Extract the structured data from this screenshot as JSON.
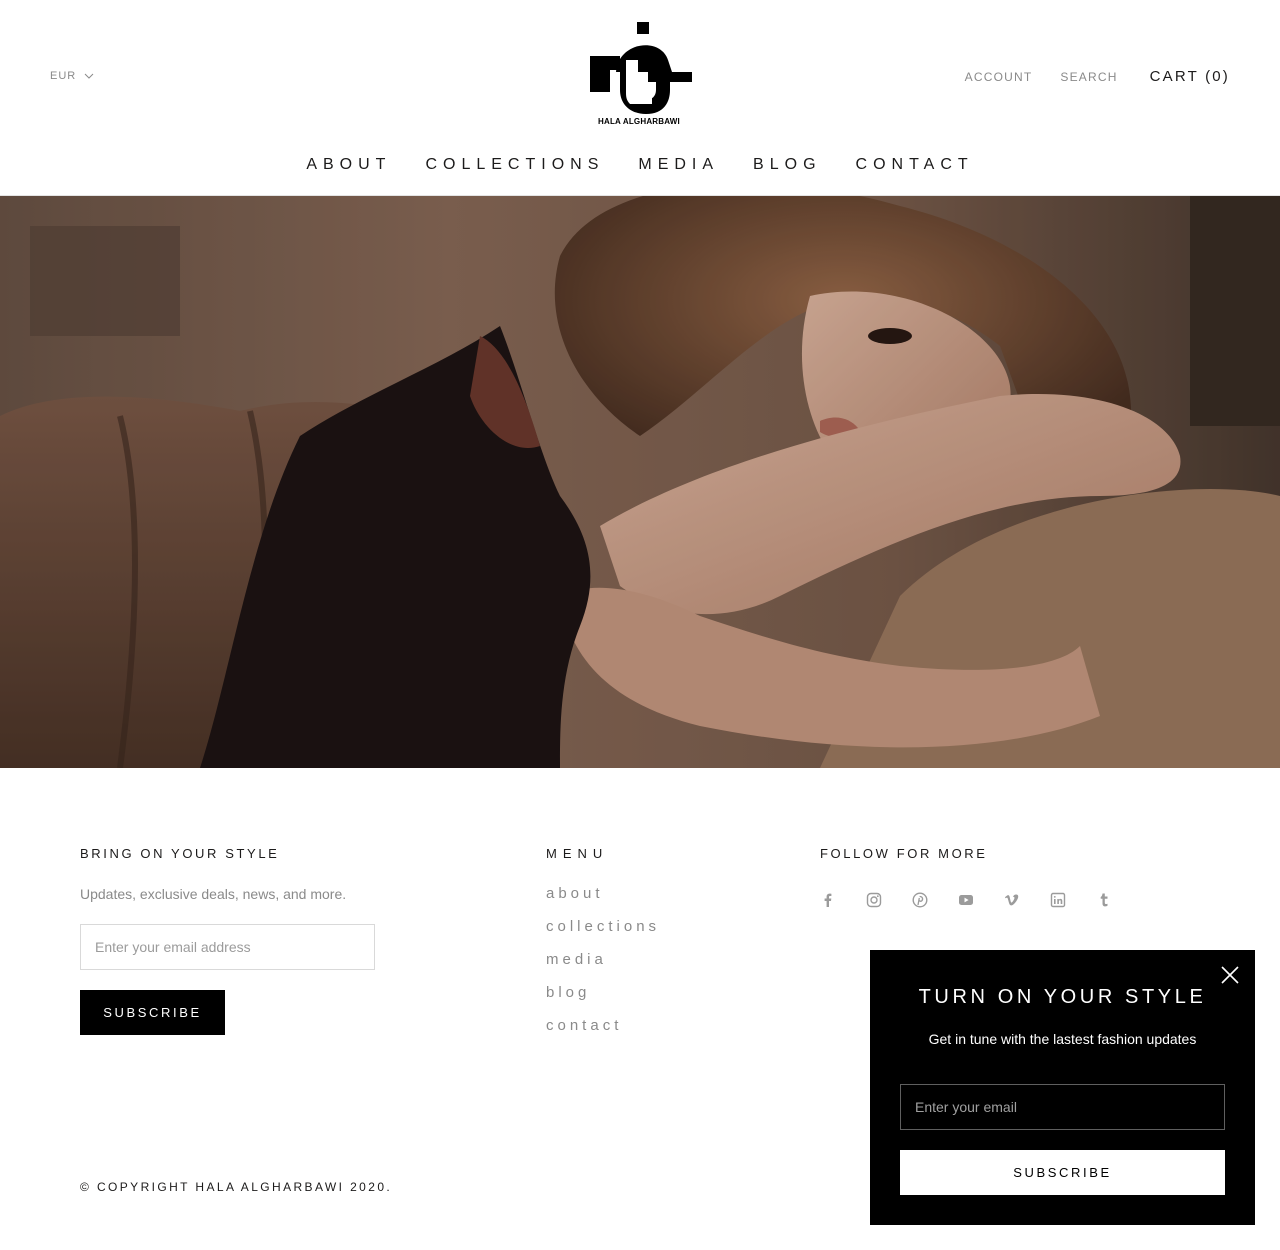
{
  "header": {
    "currency": "EUR",
    "logo_text": "HALA ALGHARBAWI",
    "account_label": "ACCOUNT",
    "search_label": "SEARCH",
    "cart_label": "CART (0)"
  },
  "nav": {
    "items": [
      {
        "label": "ABOUT"
      },
      {
        "label": "COLLECTIONS"
      },
      {
        "label": "MEDIA"
      },
      {
        "label": "BLOG"
      },
      {
        "label": "CONTACT"
      }
    ]
  },
  "footer": {
    "newsletter": {
      "heading": "BRING ON YOUR STYLE",
      "subtext": "Updates, exclusive deals, news, and more.",
      "email_placeholder": "Enter your email address",
      "subscribe_label": "SUBSCRIBE"
    },
    "menu": {
      "heading": "MENU",
      "items": [
        {
          "label": "about"
        },
        {
          "label": "collections"
        },
        {
          "label": "media"
        },
        {
          "label": "blog"
        },
        {
          "label": "contact"
        }
      ]
    },
    "follow": {
      "heading": "FOLLOW FOR MORE",
      "icons": [
        "facebook-icon",
        "instagram-icon",
        "pinterest-icon",
        "youtube-icon",
        "vimeo-icon",
        "linkedin-icon",
        "tumblr-icon"
      ]
    },
    "copyright": "© COPYRIGHT HALA ALGHARBAWI 2020."
  },
  "popup": {
    "title": "TURN ON YOUR STYLE",
    "subtitle": "Get in tune with the lastest fashion updates",
    "email_placeholder": "Enter your email",
    "subscribe_label": "SUBSCRIBE"
  },
  "colors": {
    "text": "#1c1b1b",
    "muted": "#8a8a8a",
    "button_bg": "#000000",
    "popup_bg": "#000000"
  }
}
